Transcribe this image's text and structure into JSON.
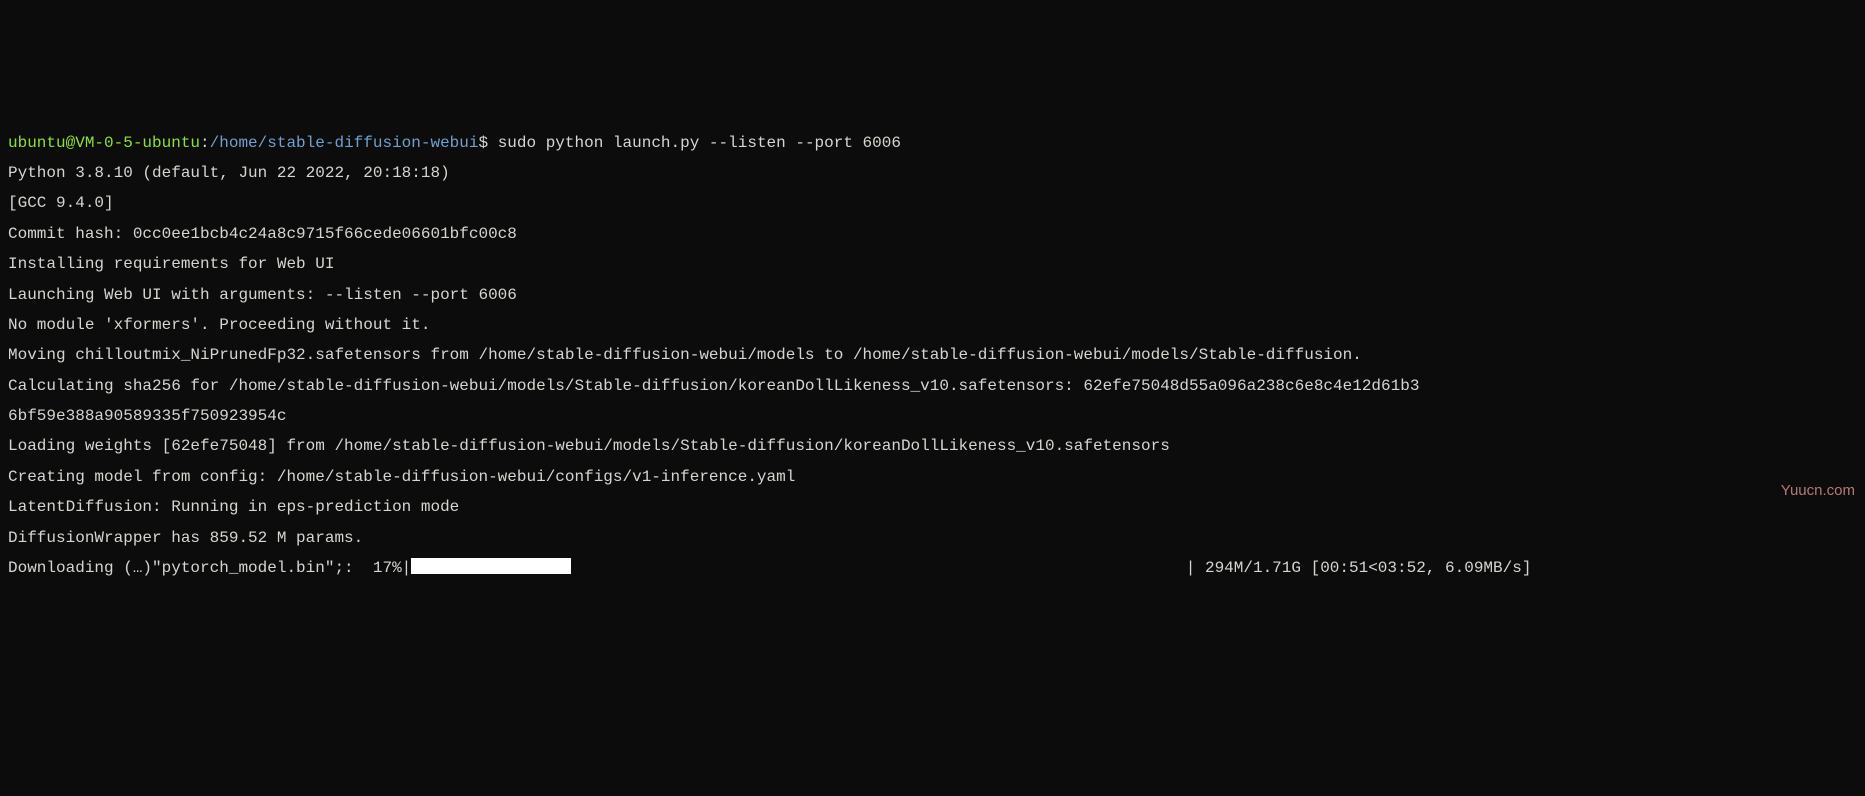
{
  "prompt": {
    "user_host": "ubuntu@VM-0-5-ubuntu",
    "sep": ":",
    "path": "/home/stable-diffusion-webui",
    "dollar": "$",
    "command": " sudo python launch.py --listen --port 6006"
  },
  "lines": {
    "l1": "Python 3.8.10 (default, Jun 22 2022, 20:18:18)",
    "l2": "[GCC 9.4.0]",
    "l3": "Commit hash: 0cc0ee1bcb4c24a8c9715f66cede06601bfc00c8",
    "l4": "Installing requirements for Web UI",
    "l5": "Launching Web UI with arguments: --listen --port 6006",
    "l6": "No module 'xformers'. Proceeding without it.",
    "l7": "Moving chilloutmix_NiPrunedFp32.safetensors from /home/stable-diffusion-webui/models to /home/stable-diffusion-webui/models/Stable-diffusion.",
    "l8": "Calculating sha256 for /home/stable-diffusion-webui/models/Stable-diffusion/koreanDollLikeness_v10.safetensors: 62efe75048d55a096a238c6e8c4e12d61b3",
    "l9": "6bf59e388a90589335f750923954c",
    "l10": "Loading weights [62efe75048] from /home/stable-diffusion-webui/models/Stable-diffusion/koreanDollLikeness_v10.safetensors",
    "l11": "Creating model from config: /home/stable-diffusion-webui/configs/v1-inference.yaml",
    "l12": "LatentDiffusion: Running in eps-prediction mode",
    "l13": "DiffusionWrapper has 859.52 M params."
  },
  "download": {
    "prefix": "Downloading (…)\"pytorch_model.bin\";:  17%|",
    "suffix": "                                                                | 294M/1.71G [00:51<03:52, 6.09MB/s]"
  },
  "watermark": "Yuucn.com"
}
